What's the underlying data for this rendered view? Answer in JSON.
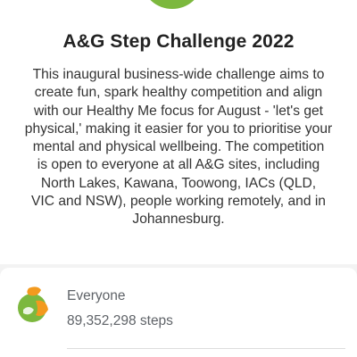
{
  "header": {
    "title": "A&G Step Challenge 2022",
    "description": "This inaugural business-wide challenge aims to\ncreate fun, spark healthy competition and align\nwith our Healthy Me focus for August - 'let's get\nphysical,' making it easier for you to prioritise your\nmental and physical wellbeing.   The competition\nis open to everyone at all A&G sites, including\nNorth Lakes, Kawana, Toowong, IACs (QLD,\nVIC and NSW), people working remotely, and in\nJohannesburg."
  },
  "leaderboard": {
    "entries": [
      {
        "name": "Everyone",
        "steps": "89,352,298 steps",
        "icon": "ag-logo-icon"
      }
    ]
  },
  "colors": {
    "brand_green": "#7cb83e",
    "brand_orange": "#f39a1e",
    "background_gray": "#f3f3f3"
  }
}
